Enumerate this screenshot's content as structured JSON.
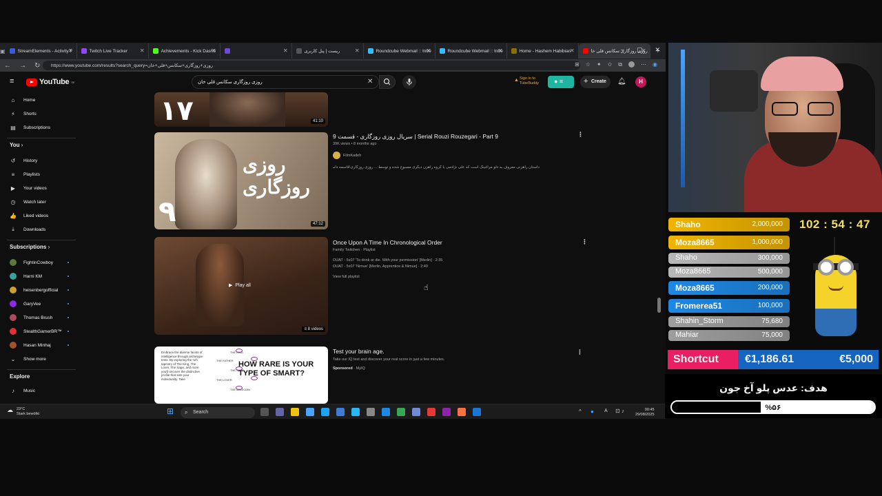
{
  "browser": {
    "tabs": [
      {
        "label": "StreamElements - Activity F",
        "color": "#3b5bdb"
      },
      {
        "label": "Twitch Live Tracker",
        "color": "#9146ff"
      },
      {
        "label": "Achievements - Kick Dashb",
        "color": "#53fc18"
      },
      {
        "label": "",
        "color": "#6a4bd1"
      },
      {
        "label": "ریست | پنل کاربری",
        "color": "#555555"
      },
      {
        "label": "Roundcube Webmail :: Inbo",
        "color": "#37beff"
      },
      {
        "label": "Roundcube Webmail :: Inbo",
        "color": "#37beff"
      },
      {
        "label": "Home - Hashem Habibian",
        "color": "#8d6e00"
      },
      {
        "label": "روزی روزگاری سکانس قلی خا",
        "color": "#ff0000"
      }
    ],
    "new_tab": "+",
    "url": "https://www.youtube.com/results?search_query=روزی+روزگاری+سکانس+قلی+خان"
  },
  "youtube": {
    "logo_text": "YouTube",
    "logo_region": "DE",
    "search_value": "روزی روزگاری سکانس قلی خان",
    "signin_line1": "Sign in to",
    "signin_line2": "TubeBuddy",
    "create_label": "Create",
    "avatar_letter": "H"
  },
  "sidebar": {
    "main": [
      {
        "label": "Home",
        "icon": "⌂"
      },
      {
        "label": "Shorts",
        "icon": "⚡"
      },
      {
        "label": "Subscriptions",
        "icon": "▤"
      }
    ],
    "you_header": "You",
    "you": [
      {
        "label": "History",
        "icon": "↺"
      },
      {
        "label": "Playlists",
        "icon": "≡"
      },
      {
        "label": "Your videos",
        "icon": "▶"
      },
      {
        "label": "Watch later",
        "icon": "◷"
      },
      {
        "label": "Liked videos",
        "icon": "👍"
      },
      {
        "label": "Downloads",
        "icon": "⤓"
      }
    ],
    "subs_header": "Subscriptions",
    "subs": [
      {
        "label": "FightinCowboy",
        "color": "#5a7a3a"
      },
      {
        "label": "Harni KM",
        "color": "#3aa0a0"
      },
      {
        "label": "heisenbergofficial",
        "color": "#c9a227"
      },
      {
        "label": "GaryVee",
        "color": "#8a2be2"
      },
      {
        "label": "Thomas Brush",
        "color": "#b04a5a"
      },
      {
        "label": "StealthGamerBR™",
        "color": "#d33"
      },
      {
        "label": "Hasan Minhaj",
        "color": "#a0522d"
      }
    ],
    "show_more": "Show more",
    "explore_header": "Explore",
    "explore_first": "Music"
  },
  "results": [
    {
      "kind": "partial",
      "duration": "41:10",
      "thumb_text": "۱۷"
    },
    {
      "title": "سریال روزی روزگاری - قسمت 9 | Serial Rouzi Rouzegari - Part 9",
      "meta": "39K views • 8 months ago",
      "channel": "FilmKadeh",
      "desc": "داستان راهزنی معروف به دلو مراغینگ است که علی نژادمی با گروه راهزن دیگری مسبوع شده و توسط ... روزی روزگاری\\قاسمه داستان سریال در ...",
      "duration": "47:12",
      "thumb_text": "روزی روزگاری",
      "thumb_num": "۹"
    },
    {
      "title": "Once Upon A Time In Chronological Order",
      "channel": "Family Twitchen · Playlist",
      "line1": "OUAT - 5x07 'To drink or die. With your permission' [Merlin] · 2:35",
      "line2": "OUAT - 5x07 'Nimue' [Merlin, Apprentice & Nimue] · 2:40",
      "view_full": "View full playlist",
      "play_all": "Play all",
      "count": "8 videos"
    },
    {
      "title": "Test your brain age.",
      "desc": "Take our IQ test and discover your real score in just a few minutes.",
      "sponsored": "Sponsored",
      "advertiser": "MyIQ",
      "ad_headline": "HOW RARE IS YOUR TYPE OF SMART?",
      "ad_body": "Embrace the diverse facets of intelligence through archetype tests. By exploring the rich tapestry of The King, The Lover, The Sage, and more you'll uncover the distinctive profile that sets your individuality. Take",
      "ad_labels": [
        "THE KING",
        "THE FATHER",
        "THE SAGE",
        "THE LOVER",
        "THE MAGICIAN"
      ]
    }
  ],
  "taskbar": {
    "weather_temp": "23°C",
    "weather_text": "Stark bewölkt",
    "search": "Search",
    "time": "00:45",
    "date": "29/08/2025"
  },
  "overlay": {
    "timer": "102 : 54 : 47",
    "leaderboard": [
      {
        "name": "Shaho",
        "amount": "2,000,000",
        "color": "#f1b500"
      },
      {
        "name": "Moza8665",
        "amount": "1,000,000",
        "color": "#f1b500"
      },
      {
        "name": "Shaho",
        "amount": "300,000",
        "color": "#b8b8b8"
      },
      {
        "name": "Moza8665",
        "amount": "500,000",
        "color": "#b8b8b8"
      },
      {
        "name": "Moza8665",
        "amount": "200,000",
        "color": "#1e88e5"
      },
      {
        "name": "Fromerea51",
        "amount": "100,000",
        "color": "#1e88e5"
      },
      {
        "name": "Shahin_Storm",
        "amount": "75,680",
        "color": "#9e9e9e"
      },
      {
        "name": "Mahiar",
        "amount": "75,000",
        "color": "#9e9e9e"
      }
    ],
    "shortcut_label": "Shortcut",
    "shortcut_current": "€1,186.61",
    "shortcut_goal": "€5,000",
    "goal_title": "هدف: عدس پلو آخ جون",
    "goal_percent_text": "%۵۶",
    "goal_progress": 0.56
  }
}
